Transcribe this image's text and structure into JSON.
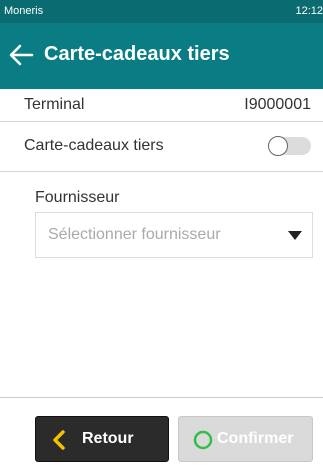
{
  "status_bar": {
    "carrier": "Moneris",
    "time": "12:12"
  },
  "header": {
    "title": "Carte-cadeaux tiers",
    "back_icon": "arrow-left-icon"
  },
  "terminal_row": {
    "label": "Terminal",
    "value": "I9000001"
  },
  "gift_card_row": {
    "label": "Carte-cadeaux tiers",
    "toggle_on": false
  },
  "supplier": {
    "label": "Fournisseur",
    "placeholder": "Sélectionner fournisseur",
    "caret_icon": "caret-down-icon"
  },
  "footer": {
    "back_label": "Retour",
    "back_icon": "chevron-left-icon",
    "confirm_label": "Confirmer",
    "confirm_icon": "circle-icon"
  },
  "colors": {
    "status_bar": "#0a6b70",
    "header": "#0a7d84",
    "accent_yellow": "#f2c200",
    "accent_green": "#2fbf4a",
    "dark_button": "#2b2b2b",
    "disabled_button": "#dadada"
  }
}
